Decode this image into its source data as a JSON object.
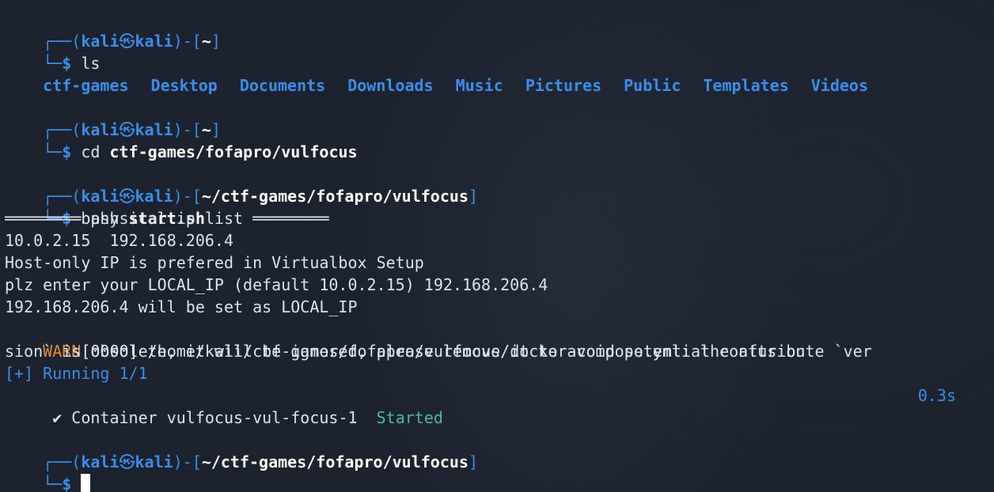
{
  "prompt": {
    "user": "kali",
    "at_symbol": "㉿",
    "host": "kali",
    "box_top": "┌──",
    "box_bottom": "└─",
    "dollar": "$"
  },
  "blocks": [
    {
      "cwd": "~",
      "command": "ls",
      "arg": ""
    },
    {
      "cwd": "~",
      "command": "cd",
      "arg": "ctf-games/fofapro/vulfocus"
    },
    {
      "cwd": "~/ctf-games/fofapro/vulfocus",
      "command": "bash",
      "arg": "start.sh"
    },
    {
      "cwd": "~/ctf-games/fofapro/vulfocus",
      "command": "",
      "arg": ""
    }
  ],
  "ls_output": [
    "ctf-games",
    "Desktop",
    "Documents",
    "Downloads",
    "Music",
    "Pictures",
    "Public",
    "Templates",
    "Videos"
  ],
  "output": {
    "header": "════════ physical ip list ════════",
    "ips": "10.0.2.15  192.168.206.4",
    "hint": "Host-only IP is prefered in Virtualbox Setup",
    "ask": "plz enter your LOCAL_IP (default 10.0.2.15) 192.168.206.4",
    "set": "192.168.206.4 will be set as LOCAL_IP",
    "warn_tag": "WARN",
    "warn_rest1": "[0000] /home/kali/ctf-games/fofapro/vulfocus/docker-compose.yml: the attribute `ver",
    "warn_rest2": "sion` is obsolete, it will be ignored, please remove it to avoid potential confusion",
    "running": "[+] Running 1/1",
    "container_check": " ✔",
    "container_name": " Container vulfocus-vul-focus-1  ",
    "container_status": "Started",
    "container_time": "0.3s"
  },
  "colors": {
    "background": "#1c222e",
    "prompt_blue": "#3b8eea",
    "warn_orange": "#e5893d",
    "started_teal": "#4fb8a0"
  }
}
